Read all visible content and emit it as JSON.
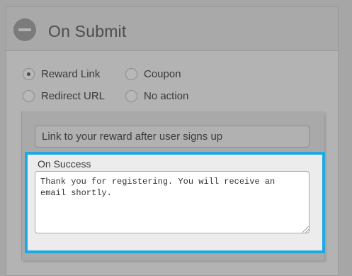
{
  "section": {
    "title": "On Submit",
    "toggle_icon": "minus-circle-icon"
  },
  "options": [
    {
      "label": "Reward Link",
      "checked": true
    },
    {
      "label": "Coupon",
      "checked": false
    },
    {
      "label": "Redirect URL",
      "checked": false
    },
    {
      "label": "No action",
      "checked": false
    }
  ],
  "reward_link": {
    "value": "Link to your reward after user signs up"
  },
  "on_success": {
    "label": "On Success",
    "message": "Thank you for registering. You will receive an email shortly."
  },
  "colors": {
    "highlight": "#1fa9e1",
    "radio_dot": "#3d5160"
  }
}
